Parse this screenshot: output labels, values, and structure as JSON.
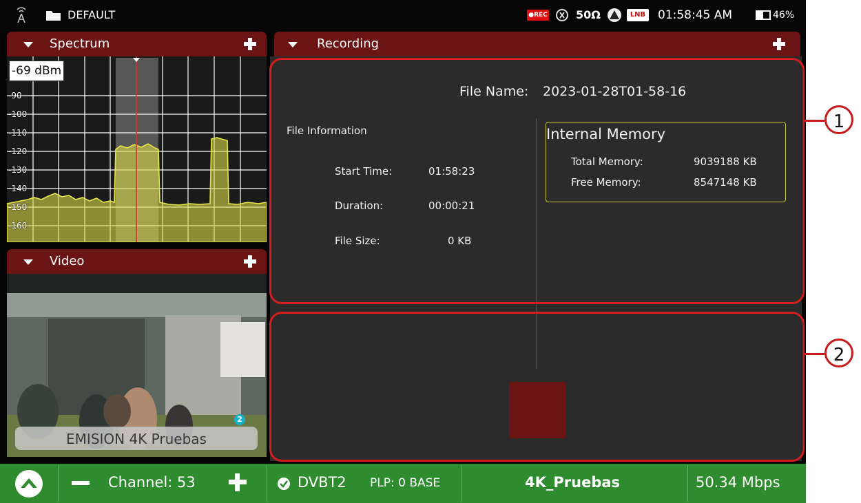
{
  "status_bar": {
    "profile": "DEFAULT",
    "rec_badge": "●REC",
    "impedance": "50Ω",
    "lnb_badge": "LNB",
    "time": "01:58:45 AM",
    "battery": "46%"
  },
  "spectrum": {
    "title": "Spectrum",
    "level_readout": "-69 dBm",
    "y_ticks": [
      "-90",
      "-100",
      "-110",
      "-120",
      "-130",
      "-140",
      "-150",
      "-160"
    ]
  },
  "video": {
    "title": "Video",
    "channel_banner": "EMISION 4K Pruebas",
    "badge": "2"
  },
  "recording": {
    "title": "Recording",
    "file_name_label": "File Name:",
    "file_name_value": "2023-01-28T01-58-16",
    "file_info_title": "File Information",
    "start_time_label": "Start Time:",
    "start_time_value": "01:58:23",
    "duration_label": "Duration:",
    "duration_value": "00:00:21",
    "file_size_label": "File Size:",
    "file_size_value": "0 KB",
    "memory_title": "Internal Memory",
    "total_memory_label": "Total Memory:",
    "total_memory_value": "9039188 KB",
    "free_memory_label": "Free Memory:",
    "free_memory_value": "8547148 KB"
  },
  "annotations": {
    "one": "1",
    "two": "2"
  },
  "bottom_bar": {
    "channel": "Channel: 53",
    "standard": "DVBT2",
    "plp": "PLP: 0 BASE",
    "service": "4K_Pruebas",
    "bitrate": "50.34 Mbps"
  },
  "colors": {
    "header_red": "#6b1414",
    "bottom_green": "#2e8b2e",
    "annotation_red": "#d41d1d",
    "trace_yellow": "#d8d84a"
  }
}
